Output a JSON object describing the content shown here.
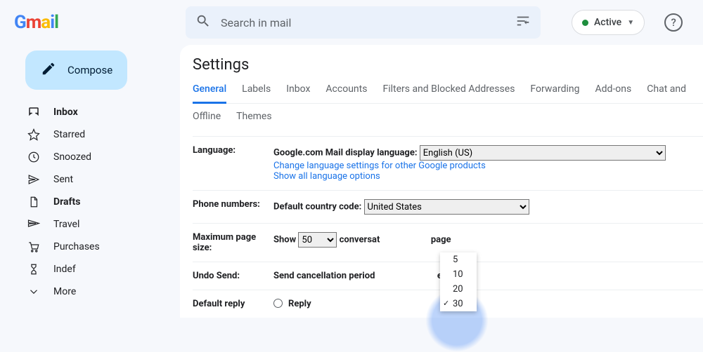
{
  "brand": {
    "name": "Gmail"
  },
  "search": {
    "placeholder": "Search in mail"
  },
  "status": {
    "label": "Active"
  },
  "compose": {
    "label": "Compose"
  },
  "sidebar": {
    "items": [
      {
        "label": "Inbox",
        "bold": true
      },
      {
        "label": "Starred"
      },
      {
        "label": "Snoozed"
      },
      {
        "label": "Sent"
      },
      {
        "label": "Drafts",
        "bold": true
      },
      {
        "label": "Travel"
      },
      {
        "label": "Purchases"
      },
      {
        "label": "Indef"
      },
      {
        "label": "More"
      }
    ]
  },
  "settings": {
    "title": "Settings",
    "tabs_row1": [
      "General",
      "Labels",
      "Inbox",
      "Accounts",
      "Filters and Blocked Addresses",
      "Forwarding",
      "Add-ons",
      "Chat and"
    ],
    "tabs_row2": [
      "Offline",
      "Themes"
    ],
    "active_tab": "General",
    "language": {
      "label": "Language:",
      "display_label": "Google.com Mail display language:",
      "value": "English (US)",
      "link1": "Change language settings for other Google products",
      "link2": "Show all language options"
    },
    "phone": {
      "label": "Phone numbers:",
      "display_label": "Default country code:",
      "value": "United States"
    },
    "pagesize": {
      "label": "Maximum page size:",
      "prefix": "Show",
      "value": "50",
      "mid": "conversat",
      "suffix": "page"
    },
    "undo": {
      "label": "Undo Send:",
      "prefix": "Send cancellation period",
      "suffix": "econds",
      "options": [
        "5",
        "10",
        "20",
        "30"
      ],
      "selected": "30"
    },
    "reply": {
      "label": "Default reply",
      "option1": "Reply"
    }
  }
}
